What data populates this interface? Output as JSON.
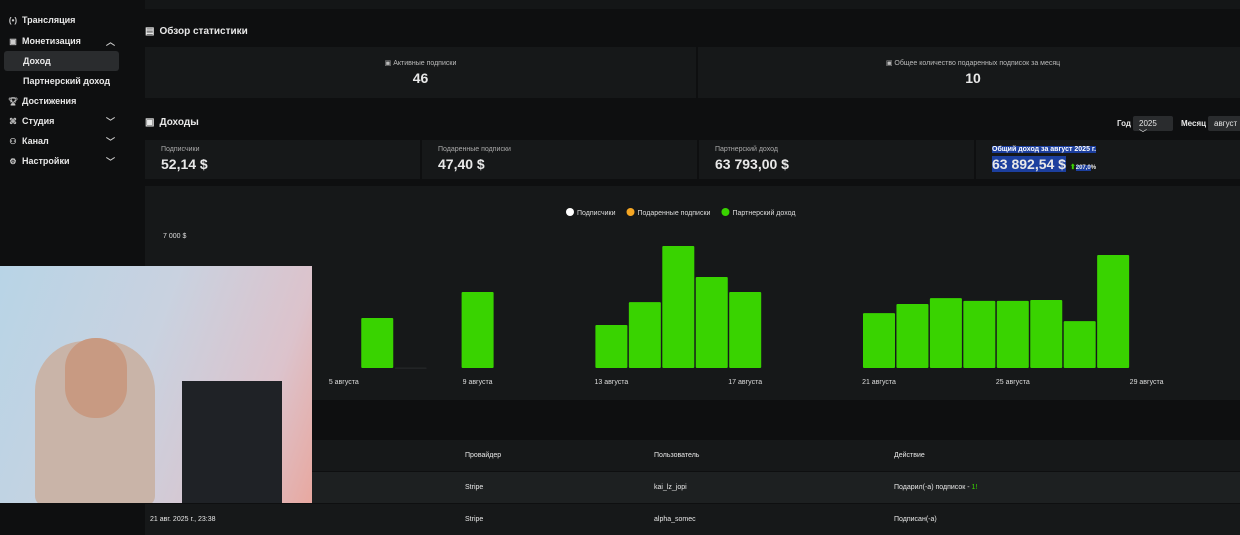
{
  "sidebar": {
    "items": [
      {
        "label": "Трансляция",
        "icon": "broadcast-icon"
      },
      {
        "label": "Монетизация",
        "icon": "monetization-icon",
        "expanded": true
      },
      {
        "label": "Доход",
        "active": true
      },
      {
        "label": "Партнерский доход"
      },
      {
        "label": "Достижения",
        "icon": "trophy-icon"
      },
      {
        "label": "Студия",
        "icon": "studio-icon"
      },
      {
        "label": "Канал",
        "icon": "channel-icon"
      },
      {
        "label": "Настройки",
        "icon": "gear-icon"
      }
    ]
  },
  "overview": {
    "title": "Обзор статистики",
    "cards": [
      {
        "label": "Активные подписки",
        "value": "46"
      },
      {
        "label": "Общее количество подаренных подписок за месяц",
        "value": "10"
      }
    ]
  },
  "income": {
    "title": "Доходы",
    "year_label": "Год",
    "year": "2025",
    "month_label": "Месяц",
    "month": "август",
    "cards": [
      {
        "label": "Подписчики",
        "value": "52,14 $"
      },
      {
        "label": "Подаренные подписки",
        "value": "47,40 $"
      },
      {
        "label": "Партнерский доход",
        "value": "63 793,00 $"
      },
      {
        "label": "Общий доход за август 2025 г.",
        "value": "63 892,54 $",
        "change": "207,0",
        "change_unit": "%"
      }
    ]
  },
  "colors": {
    "accent": "#39d300",
    "selection": "#1c3f9e",
    "orange": "#f5a623"
  },
  "chart_data": {
    "type": "bar",
    "legend_position": "top-center",
    "series": [
      {
        "name": "Подписчики",
        "color": "#ffffff"
      },
      {
        "name": "Подаренные подписки",
        "color": "#f5a623"
      },
      {
        "name": "Партнерский доход",
        "color": "#39d300"
      }
    ],
    "y_ticks": [
      "7 000 $"
    ],
    "ylim": [
      0,
      7000
    ],
    "x_ticks": [
      "5 августа",
      "9 августа",
      "13 августа",
      "17 августа",
      "21 августа",
      "25 августа",
      "29 августа"
    ],
    "days": [
      6,
      7,
      9,
      13,
      14,
      15,
      16,
      17,
      21,
      22,
      23,
      24,
      25,
      26,
      27,
      28
    ],
    "values": [
      2630,
      20,
      4000,
      2260,
      3470,
      6420,
      4790,
      4000,
      2890,
      3370,
      3680,
      3530,
      3530,
      3580,
      2470,
      5950
    ]
  },
  "table": {
    "headers": [
      "",
      "Провайдер",
      "Пользователь",
      "Действие"
    ],
    "rows": [
      [
        "",
        "Stripe",
        "kai_lz_jopi",
        "Подарил(-а) подписок - ",
        "1!"
      ],
      [
        "21 авг. 2025 г., 23:38",
        "Stripe",
        "alpha_somec",
        "Подписан(-а)",
        ""
      ]
    ]
  }
}
